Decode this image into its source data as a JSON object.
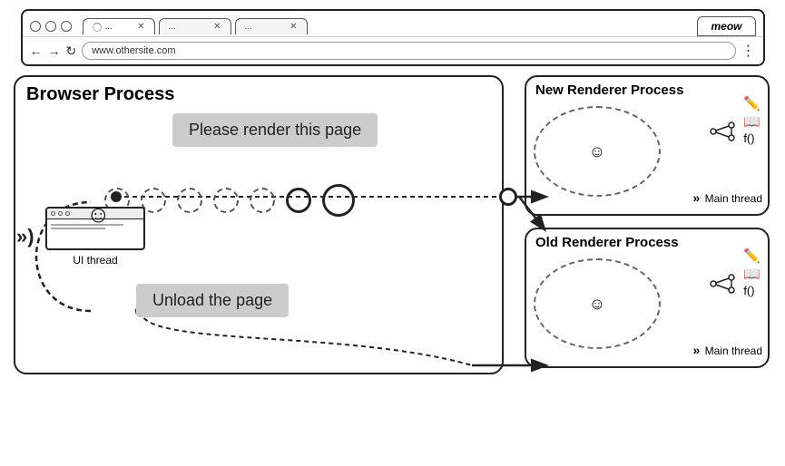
{
  "browser": {
    "tabs": [
      {
        "label": "...",
        "active": true,
        "loading": true
      },
      {
        "label": "...",
        "active": false
      },
      {
        "label": "...",
        "active": false
      }
    ],
    "special_tab": "meow",
    "address": "www.othersite.com",
    "nav": {
      "back": "←",
      "forward": "→",
      "refresh": "↻",
      "menu": "⋮"
    }
  },
  "diagram": {
    "browser_process_title": "Browser Process",
    "new_renderer_title": "New Renderer Process",
    "old_renderer_title": "Old Renderer Process",
    "message_render": "Please render this page",
    "message_unload": "Unload the page",
    "ui_thread_label": "UI thread",
    "main_thread_label": "Main thread",
    "chevrons": "»)",
    "chevrons_right": "»"
  }
}
